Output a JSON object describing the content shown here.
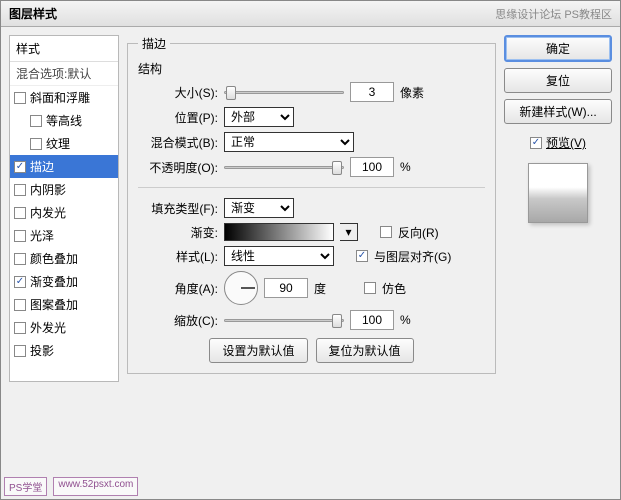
{
  "titlebar": {
    "title": "图层样式",
    "right": "思缘设计论坛  PS教程区"
  },
  "left": {
    "header": "样式",
    "sub": "混合选项:默认",
    "items": [
      {
        "label": "斜面和浮雕",
        "checked": false,
        "child": false
      },
      {
        "label": "等高线",
        "checked": false,
        "child": true
      },
      {
        "label": "纹理",
        "checked": false,
        "child": true
      },
      {
        "label": "描边",
        "checked": true,
        "child": false,
        "selected": true
      },
      {
        "label": "内阴影",
        "checked": false,
        "child": false
      },
      {
        "label": "内发光",
        "checked": false,
        "child": false
      },
      {
        "label": "光泽",
        "checked": false,
        "child": false
      },
      {
        "label": "颜色叠加",
        "checked": false,
        "child": false
      },
      {
        "label": "渐变叠加",
        "checked": true,
        "child": false
      },
      {
        "label": "图案叠加",
        "checked": false,
        "child": false
      },
      {
        "label": "外发光",
        "checked": false,
        "child": false
      },
      {
        "label": "投影",
        "checked": false,
        "child": false
      }
    ]
  },
  "stroke": {
    "legend": "描边",
    "structure_label": "结构",
    "size_label": "大小(S):",
    "size_value": "3",
    "size_unit": "像素",
    "position_label": "位置(P):",
    "position_value": "外部",
    "blend_label": "混合模式(B):",
    "blend_value": "正常",
    "opacity_label": "不透明度(O):",
    "opacity_value": "100",
    "percent": "%"
  },
  "fill": {
    "filltype_label": "填充类型(F):",
    "filltype_value": "渐变",
    "gradient_label": "渐变:",
    "reverse_label": "反向(R)",
    "style_label": "样式(L):",
    "style_value": "线性",
    "align_label": "与图层对齐(G)",
    "angle_label": "角度(A):",
    "angle_value": "90",
    "angle_unit": "度",
    "dither_label": "仿色",
    "scale_label": "缩放(C):",
    "scale_value": "100",
    "percent": "%",
    "set_default": "设置为默认值",
    "reset_default": "复位为默认值"
  },
  "right": {
    "ok": "确定",
    "cancel": "复位",
    "new_style": "新建样式(W)...",
    "preview_label": "预览(V)"
  },
  "footer": {
    "tag1": "PS学堂",
    "tag2": "www.52psxt.com"
  }
}
